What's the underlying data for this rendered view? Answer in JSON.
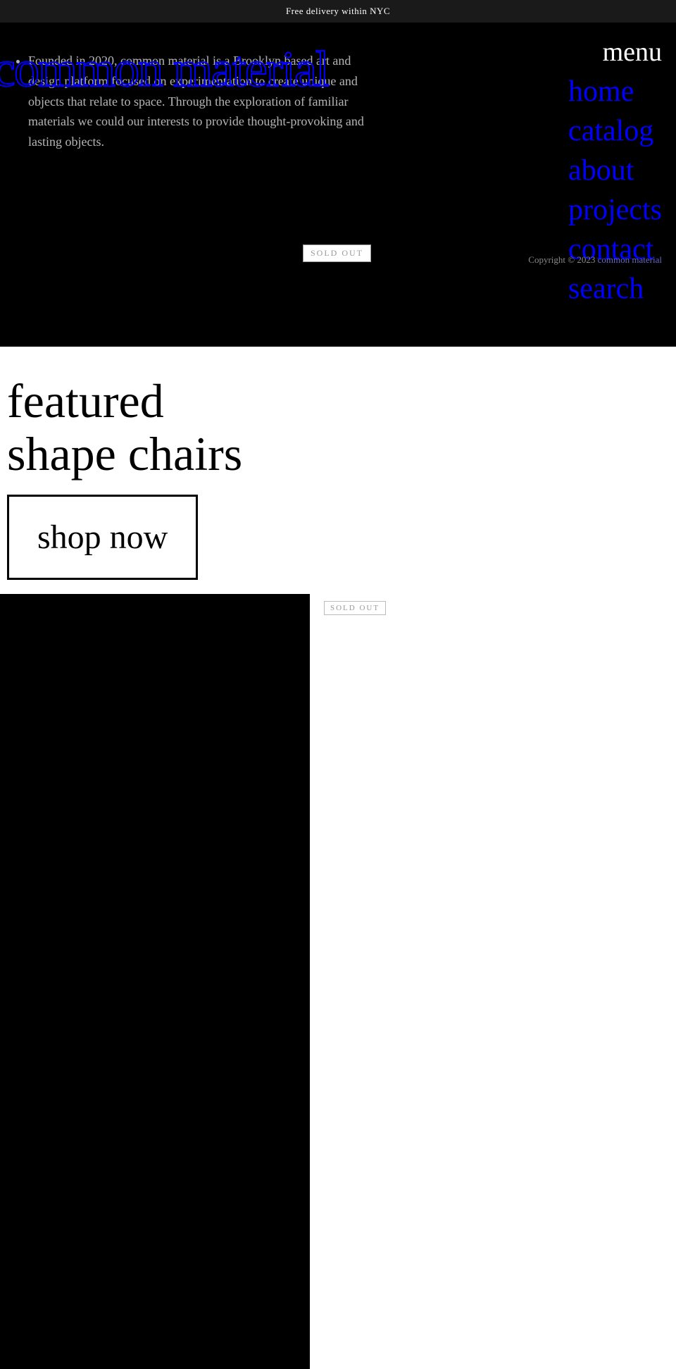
{
  "announcement": {
    "text": "Free delivery within NYC"
  },
  "site": {
    "title": "common material"
  },
  "nav": {
    "menu_label": "menu",
    "links": [
      {
        "label": "home",
        "href": "#"
      },
      {
        "label": "catalog",
        "href": "#"
      },
      {
        "label": "about",
        "href": "#"
      },
      {
        "label": "projects",
        "href": "#"
      },
      {
        "label": "contact",
        "href": "#"
      },
      {
        "label": "search",
        "href": "#"
      }
    ]
  },
  "about": {
    "description": "Founded in 2020, common material is a Brooklyn based art and design platform focused on experimentation to create unique and objects that relate to space. Through the exploration of familiar materials we could our interests to provide thought-provoking and lasting objects."
  },
  "sold_out_badge": "SOLD OUT",
  "copyright": {
    "text": "Copyright © 2023 ",
    "brand": "common material"
  },
  "featured": {
    "title_line1": "featured",
    "title_line2": "shape chairs",
    "shop_now": "shop now"
  }
}
